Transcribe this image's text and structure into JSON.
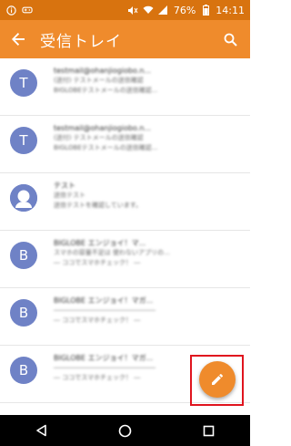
{
  "status_bar": {
    "battery": "76%",
    "time": "14:11"
  },
  "app_bar": {
    "title": "受信トレイ"
  },
  "messages": [
    {
      "initial": "T",
      "sender": "testmail@ohanjiogiobo.n...",
      "date": "",
      "lines": [
        "(送付) テストメールの送信確認",
        "BIGLOBEテストメールの送信確認..."
      ]
    },
    {
      "initial": "T",
      "sender": "testmail@ohanjiogiobo.n...",
      "date": "",
      "lines": [
        "(送付) テストメールの送信確認",
        "BIGLOBEテストメールの送信確認..."
      ]
    },
    {
      "initial": "",
      "sender": "テスト",
      "date": "",
      "avatar_type": "person",
      "lines": [
        "送信テスト",
        "送信テストを確認しています。"
      ]
    },
    {
      "initial": "B",
      "sender": "BIGLOBE エンジョイ！マ...",
      "date": "",
      "lines": [
        "スマホの容量不足は 使わないアプリの…",
        "― ココでスマホチェック！ ―"
      ]
    },
    {
      "initial": "B",
      "sender": "BIGLOBE エンジョイ！マガ...",
      "date": "",
      "lines": [
        "――――――――――――――――",
        "― ココでスマホチェック！ ―"
      ]
    },
    {
      "initial": "B",
      "sender": "BIGLOBE エンジョイ！マガ...",
      "date": "",
      "lines": [
        "――――――――――――――――",
        "― ココでスマホチェック！ ―"
      ]
    }
  ]
}
